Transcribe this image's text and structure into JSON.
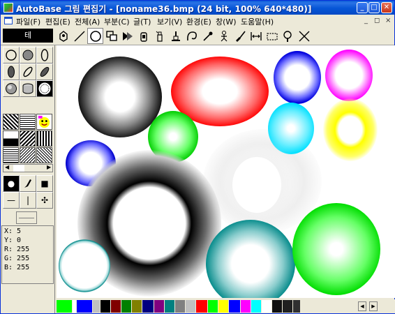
{
  "window": {
    "title": "AutoBase 그림 편집기 - [noname36.bmp (24 bit, 100% 640*480)]",
    "controls": {
      "minimize": "_",
      "maximize": "□",
      "close": "✕"
    }
  },
  "menu": {
    "items": [
      "파일(F)",
      "편집(E)",
      "전체(A)",
      "부분(C)",
      "글(T)",
      "보기(V)",
      "환경(E)",
      "창(W)",
      "도움말(H)"
    ],
    "mdi_controls": {
      "minimize": "_",
      "restore": "◻",
      "close": "×"
    }
  },
  "toolbar": {
    "current_color_label": "테",
    "tools": [
      "bucket-fill",
      "line",
      "circle",
      "rectangles",
      "arrow",
      "spray-can",
      "bottle",
      "stamp",
      "curve",
      "eyedropper",
      "figure",
      "brush",
      "resize",
      "rect-select",
      "magnifier",
      "clear"
    ]
  },
  "shape_tools": [
    "ellipse-outline",
    "ellipse-gray",
    "ellipse-tall",
    "ellipse-dark",
    "leaf-outline",
    "leaf-dark",
    "circle-shaded",
    "cylinder",
    "circle-radial"
  ],
  "brush_tools": [
    "dot-brush",
    "pen",
    "square-brush",
    "horizontal-line",
    "vertical-line",
    "cross-move"
  ],
  "coords": {
    "x": "X: 5",
    "y": "Y: 0",
    "r": "R: 255",
    "g": "G: 255",
    "b": "B: 255"
  },
  "palette": {
    "colors": [
      "#00ff00",
      "#ffffff",
      "#0000ff",
      "#c0c0c0",
      "#000000",
      "#800000",
      "#008000",
      "#808000",
      "#000080",
      "#800080",
      "#008080",
      "#808080",
      "#c0c0c0",
      "#ff0000",
      "#00ff00",
      "#ffff00",
      "#0000ff",
      "#ff00ff",
      "#00ffff",
      "#ffffff",
      "#101010",
      "#202020",
      "#303030"
    ],
    "gradient_start": "#00ee00",
    "gradient_end": "#000000"
  }
}
